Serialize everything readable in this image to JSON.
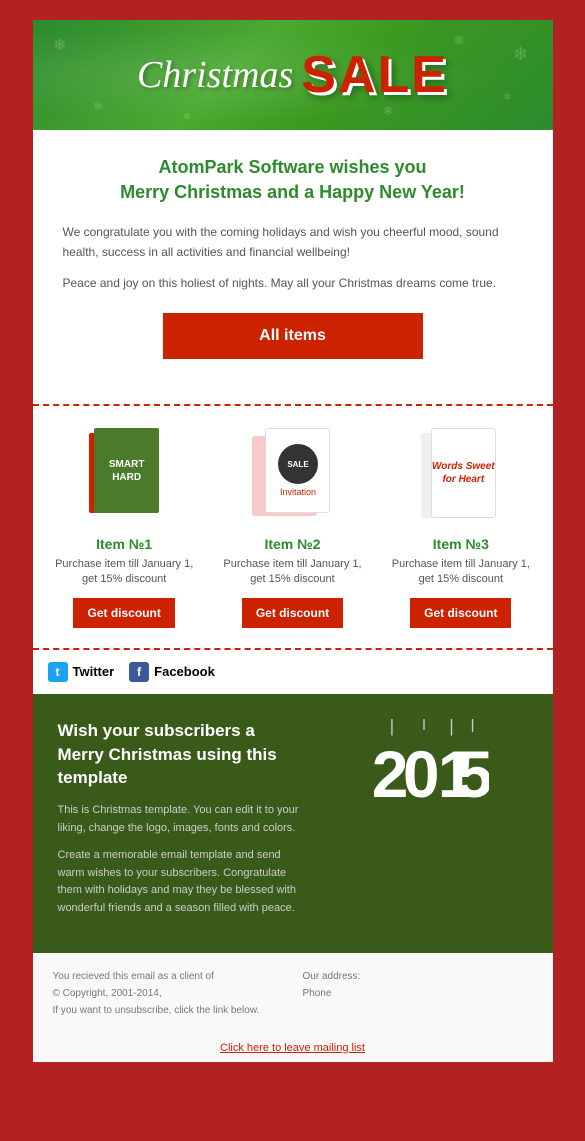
{
  "header": {
    "christmas_text": "Christmas",
    "sale_text": "SALE"
  },
  "greeting": {
    "title_line1": "AtomPark Software wishes you",
    "title_line2": "Merry Christmas and a Happy New Year!",
    "para1": "We congratulate you with the coming holidays and wish you cheerful mood, sound health, success in all activities and financial wellbeing!",
    "para2": "Peace and joy on this holiest of nights. May all your Christmas dreams come true."
  },
  "all_items_button": "All items",
  "items": [
    {
      "name": "Item №1",
      "description": "Purchase item till January 1, get 15% discount",
      "button": "Get discount",
      "book_line1": "SMART",
      "book_line2": "HARD"
    },
    {
      "name": "Item №2",
      "description": "Purchase item till January 1, get 15% discount",
      "button": "Get discount",
      "sale_text": "SALE",
      "invitation": "Invitation"
    },
    {
      "name": "Item №3",
      "description": "Purchase item till January 1, get 15% discount",
      "button": "Get discount",
      "card_text": "Words Sweet for Heart"
    }
  ],
  "social": {
    "twitter_label": "Twitter",
    "facebook_label": "Facebook"
  },
  "promo": {
    "title": "Wish your subscribers a Merry Christmas using this template",
    "para1": "This is Christmas template. You can edit it to your liking, change the logo, images, fonts and colors.",
    "para2": "Create a memorable email template and send warm wishes to your subscribers. Congratulate them with holidays and may they be blessed with wonderful friends and a season filled with peace.",
    "year": "2015"
  },
  "footer": {
    "left_line1": "You recieved this email as a client of",
    "left_line2": "© Copyright, 2001-2014,",
    "left_line3": "If you want to unsubscribe, click the link below.",
    "right_label1": "Our address:",
    "right_value1": "",
    "right_label2": "Phone",
    "right_value2": "",
    "unsubscribe": "Click here to leave mailing list"
  }
}
